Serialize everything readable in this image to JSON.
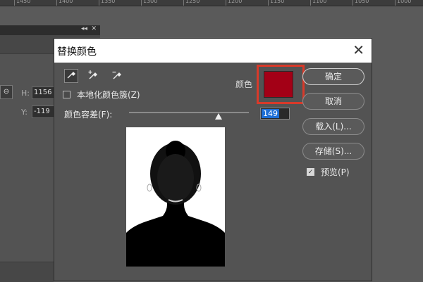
{
  "ruler": {
    "labels": [
      "1450",
      "1400",
      "1350",
      "1300",
      "1250",
      "1200",
      "1150",
      "1100",
      "1050",
      "1000"
    ]
  },
  "background_panel": {
    "h_label": "H:",
    "h_value": "1156",
    "y_label": "Y:",
    "y_value": "-119",
    "link_icon": "link-icon"
  },
  "dialog": {
    "title": "替换颜色",
    "tools": [
      "eyedropper-icon",
      "eyedropper-plus-icon",
      "eyedropper-minus-icon"
    ],
    "localized_clusters_label": "本地化颜色簇(Z)",
    "localized_clusters_checked": false,
    "color_label": "颜色",
    "color_swatch": "#a30016",
    "fuzziness_label": "颜色容差(F):",
    "fuzziness_value": "149",
    "fuzziness_max": 200,
    "buttons": {
      "ok": "确定",
      "cancel": "取消",
      "load": "载入(L)...",
      "save": "存储(S)..."
    },
    "preview_label": "预览(P)",
    "preview_checked": true
  },
  "colors": {
    "highlight": "#d83a2a",
    "selection": "#1e6fd6"
  }
}
